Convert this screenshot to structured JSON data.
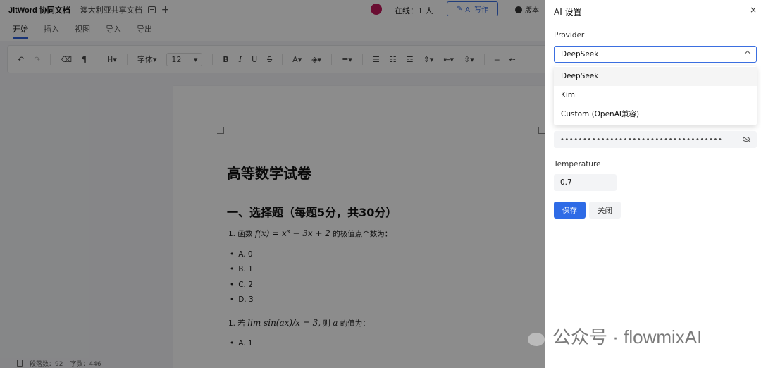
{
  "header": {
    "app_title": "JitWord 协同文档",
    "doc_name": "澳大利亚共享文档",
    "plus": "+",
    "online": "在线：1 人",
    "ai_write": "AI 写作",
    "version": "版本"
  },
  "menu": {
    "tabs": [
      "开始",
      "插入",
      "视图",
      "导入",
      "导出"
    ]
  },
  "toolbar": {
    "heading": "H",
    "font": "字体",
    "font_size": "12",
    "bold": "B",
    "italic": "I",
    "underline": "U",
    "strike": "S",
    "text_color": "A"
  },
  "document": {
    "title": "高等数学试卷",
    "section": "一、选择题（每题5分，共30分）",
    "q1_prefix": "1. 函数",
    "q1_math": "f(x) = x³ − 3x + 2",
    "q1_suffix": "的极值点个数为：",
    "q1_options": [
      "A. 0",
      "B. 1",
      "C. 2",
      "D. 3"
    ],
    "q2_prefix": "1. 若",
    "q2_math": "lim sin(ax)/x = 3,",
    "q2_mid": "则",
    "q2_var": "a",
    "q2_suffix": "的值为：",
    "q2_options": [
      "A. 1"
    ]
  },
  "status": {
    "paragraphs": "段落数：92",
    "words": "字数：446"
  },
  "ai_settings": {
    "title": "AI 设置",
    "close_symbol": "×",
    "provider_label": "Provider",
    "provider_value": "DeepSeek",
    "provider_options": [
      "DeepSeek",
      "Kimi",
      "Custom (OpenAI兼容)"
    ],
    "api_key_masked": "••••••••••••••••••••••••••••••••••••",
    "temperature_label": "Temperature",
    "temperature_value": "0.7",
    "save_label": "保存",
    "close_label": "关闭"
  },
  "watermark": {
    "text": "公众号 · flowmixAI"
  },
  "colors": {
    "accent": "#2e6be6",
    "overlay": "rgba(0,0,0,0.45)"
  }
}
